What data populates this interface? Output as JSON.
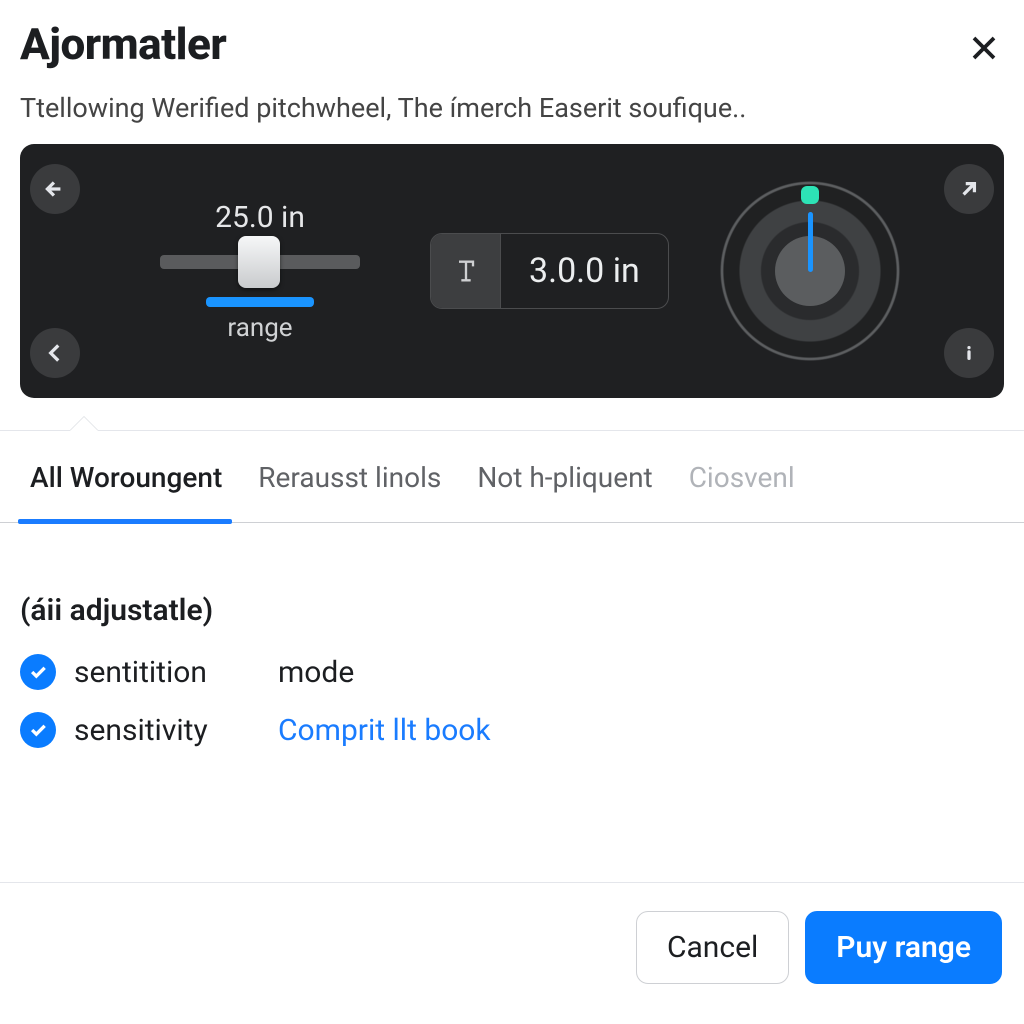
{
  "header": {
    "title": "Ajormatler",
    "subtitle": "Ttellowing Werified pitchwheel, The ímerch Easerit soufique.."
  },
  "panel": {
    "slider_value": "25.0 in",
    "slider_label": "range",
    "num_value": "3.0.0 in"
  },
  "tabs": [
    {
      "label": "All Woroungent",
      "state": "active"
    },
    {
      "label": "Rerausst linols",
      "state": "normal"
    },
    {
      "label": "Not h-pliquent",
      "state": "normal"
    },
    {
      "label": "Ciosvenl",
      "state": "disabled"
    }
  ],
  "options": {
    "heading": "(áii adjustatle)",
    "rows": [
      {
        "checked": true,
        "label": "sentitition",
        "value": "mode",
        "is_link": false
      },
      {
        "checked": true,
        "label": "sensitivity",
        "value": "Comprit llt book",
        "is_link": true
      }
    ]
  },
  "footer": {
    "cancel": "Cancel",
    "primary": "Puy range"
  }
}
